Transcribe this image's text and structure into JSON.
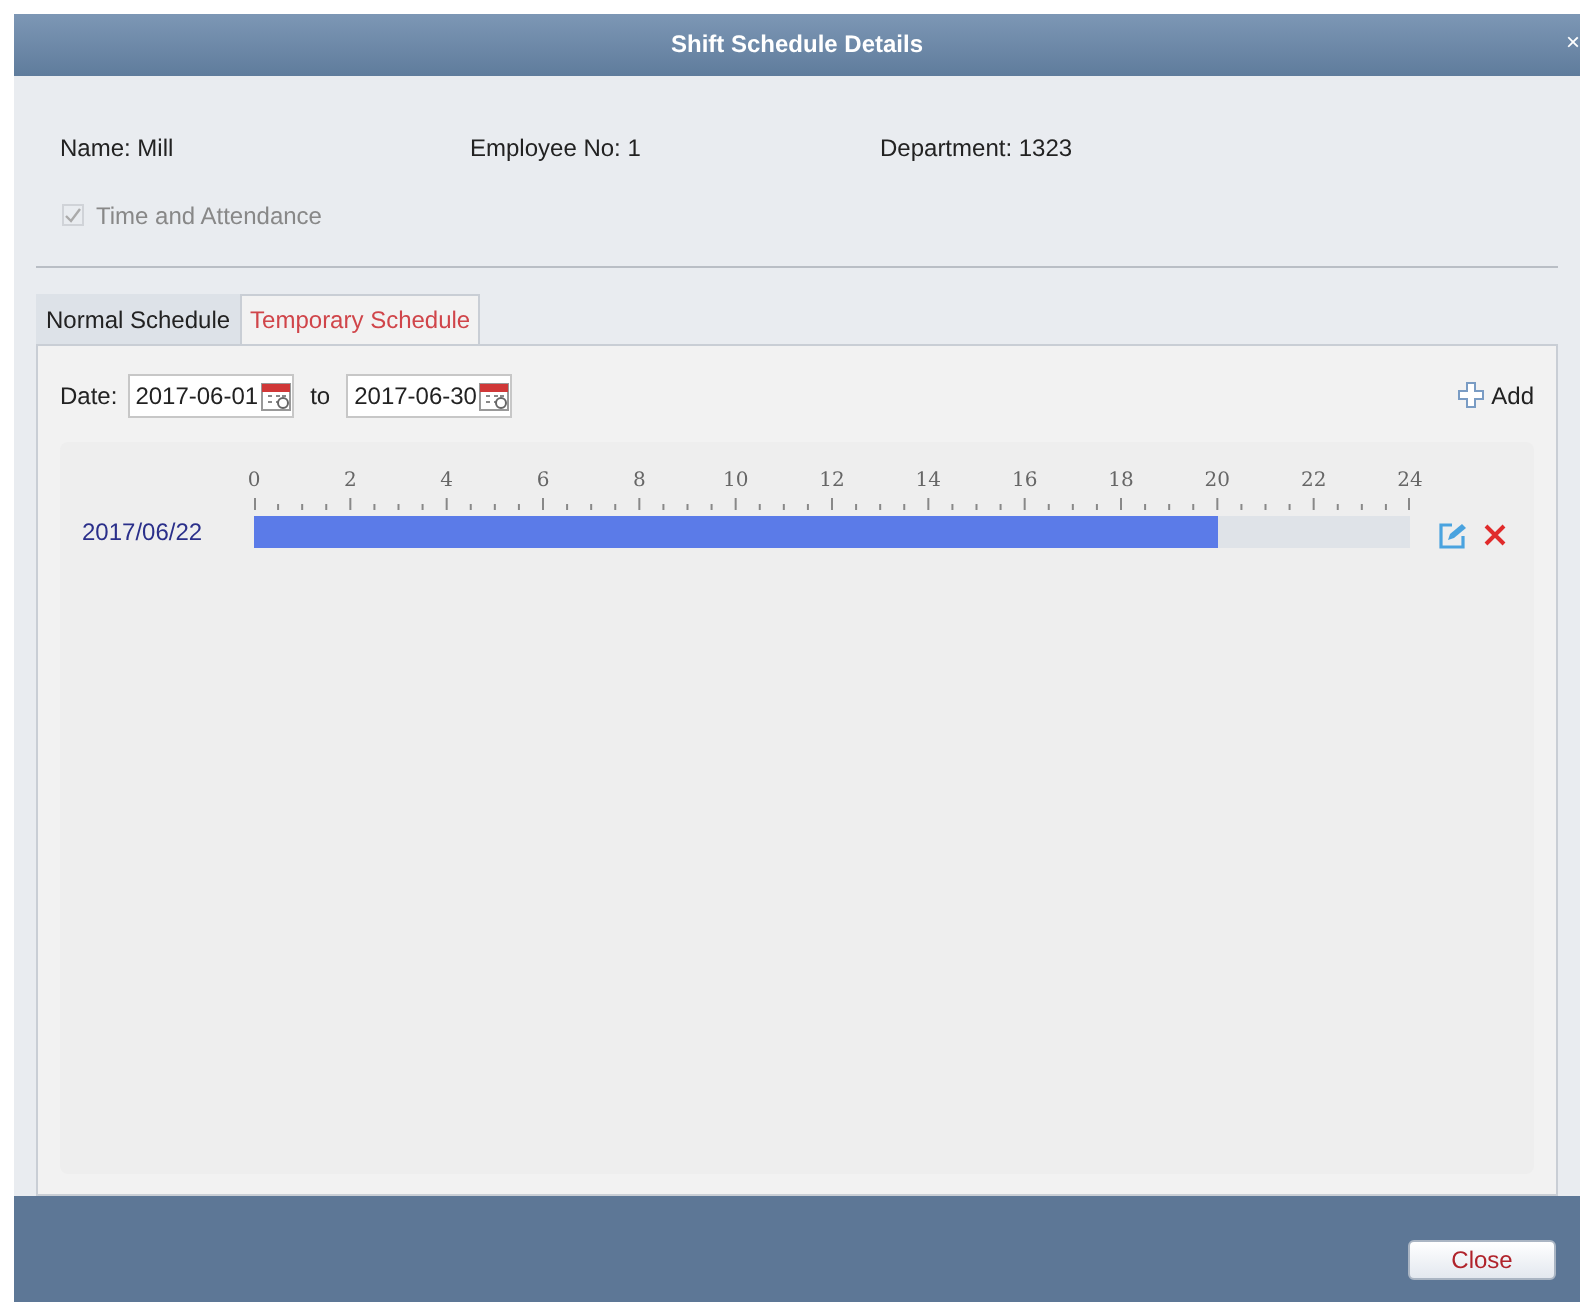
{
  "window": {
    "title": "Shift Schedule Details",
    "close": "×"
  },
  "info": [
    {
      "text": "Name: Mill"
    },
    {
      "text": "Employee No: 1"
    },
    {
      "text": "Department: 1323"
    }
  ],
  "attendance": {
    "label": "Time and Attendance",
    "checked": true,
    "disabled": true
  },
  "tabs": [
    {
      "label": "Normal Schedule",
      "selected": false
    },
    {
      "label": "Temporary Schedule",
      "selected": true
    }
  ],
  "date_filter": {
    "label": "Date:",
    "from": "2017-06-01",
    "separator": "to",
    "to": "2017-06-30"
  },
  "add_button": {
    "label": "Add"
  },
  "timeline": {
    "ticks": [
      "0",
      "2",
      "4",
      "6",
      "8",
      "10",
      "12",
      "14",
      "16",
      "18",
      "20",
      "22",
      "24"
    ],
    "rows": [
      {
        "date": "2017/06/22",
        "level": 0.8333
      }
    ]
  },
  "footer": {
    "close": "Close"
  }
}
